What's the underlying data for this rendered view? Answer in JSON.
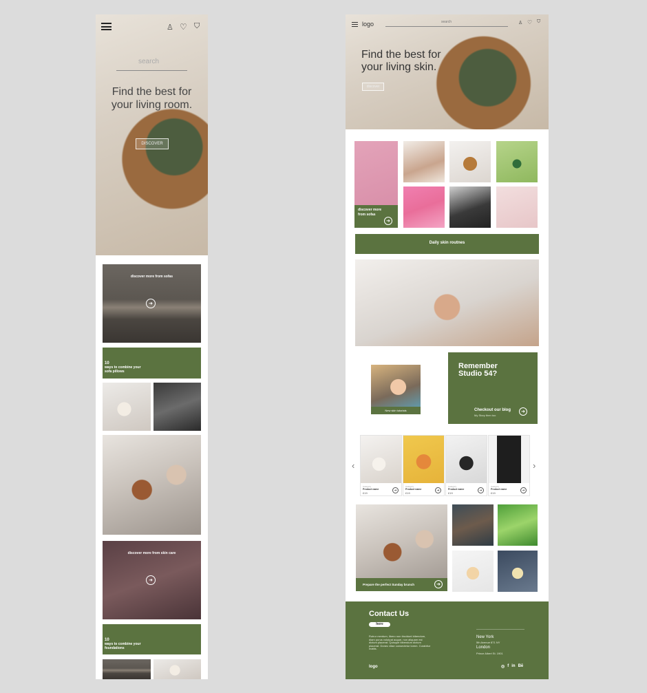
{
  "mobile": {
    "search_placeholder": "search",
    "hero_title": "Find the best for your living room.",
    "discover_label": "DISCOVER",
    "sofas_card": {
      "label": "discover more from sofas"
    },
    "pillows_card": {
      "number": "10",
      "text": "ways to combine your sofa pillows"
    },
    "skin_card": {
      "label": "discover more from skin care"
    },
    "foundations_card": {
      "number": "10",
      "text": "ways to combine your foundations"
    }
  },
  "desktop": {
    "logo": "logo",
    "search_placeholder": "search",
    "hero_title": "Find the best for your living skin.",
    "discover_label": "discover",
    "sofas_tile": {
      "label": "discover more from sofas"
    },
    "daily_routines": "Daily skin routnes",
    "tutorials_caption": "New skin tutorials",
    "blog": {
      "title": "Remember Studio 54?",
      "link": "Checkout our blog",
      "sub": "My Story then too"
    },
    "products": [
      {
        "name": "Product name",
        "category": "Category",
        "price": "£19"
      },
      {
        "name": "Product name",
        "category": "Category",
        "price": "£19"
      },
      {
        "name": "Product name",
        "category": "Category",
        "price": "£19"
      },
      {
        "name": "Product name",
        "category": "Category",
        "price": "£19"
      }
    ],
    "brunch_label": "Prepare the perfect Sunday brunch",
    "footer": {
      "title": "Contact Us",
      "button": "here",
      "body": "Rutrur mentum, libero non tincidunt bibendum, diam purus volutpat augue, non aliquam est dictum placerat. Quisque bibendum dictum placerat. Donec vitae consectetur lorem. Curabitur mattis.",
      "city": "New York",
      "address1": "5th Avenue 871 NY",
      "city2": "London",
      "address2": "Prince Albert St. 1901",
      "logo": "logo",
      "social": [
        "◎",
        "f",
        "in",
        "Bē"
      ]
    }
  },
  "colors": {
    "accent_green": "#5b7340",
    "background": "#dcdcdc"
  }
}
